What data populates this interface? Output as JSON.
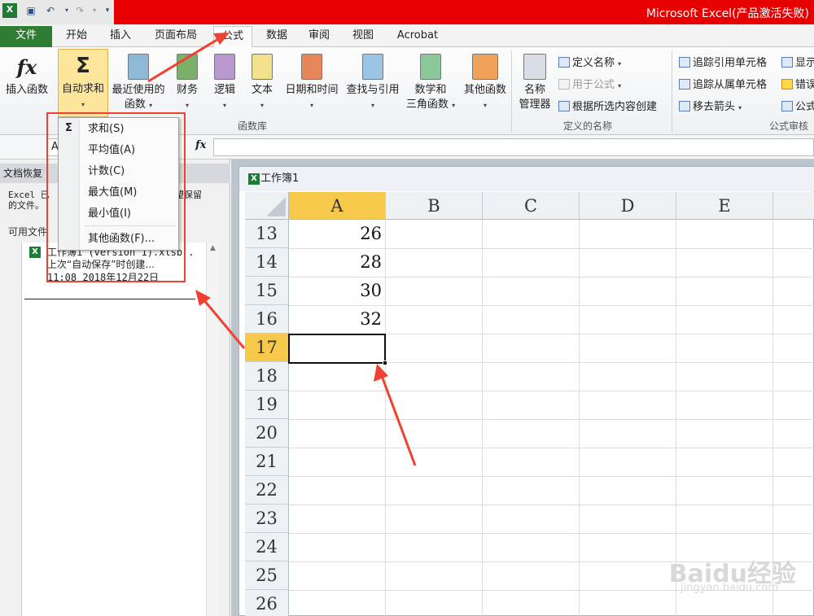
{
  "window": {
    "title": "Microsoft Excel(产品激活失败)"
  },
  "tabs": {
    "file": "文件",
    "items": [
      "开始",
      "插入",
      "页面布局",
      "公式",
      "数据",
      "审阅",
      "视图",
      "Acrobat"
    ]
  },
  "ribbon": {
    "insert_function": "插入函数",
    "autosum": "自动求和",
    "recent_line1": "最近使用的",
    "recent_line2": "函数",
    "financial": "财务",
    "logical": "逻辑",
    "text": "文本",
    "datetime": "日期和时间",
    "lookup": "查找与引用",
    "math_line1": "数学和",
    "math_line2": "三角函数",
    "other": "其他函数",
    "library_group": "函数库",
    "name_mgr_line1": "名称",
    "name_mgr_line2": "管理器",
    "define_name": "定义名称",
    "use_in_formula": "用于公式",
    "create_from_sel": "根据所选内容创建",
    "names_group": "定义的名称",
    "trace_precedents": "追踪引用单元格",
    "trace_dependents": "追踪从属单元格",
    "remove_arrows": "移去箭头",
    "show_partial": "显示",
    "error_partial": "错误",
    "eval_partial": "公式",
    "audit_group": "公式审核"
  },
  "autosum_menu": {
    "sigma": "Σ",
    "items": [
      "求和(S)",
      "平均值(A)",
      "计数(C)",
      "最大值(M)",
      "最小值(I)"
    ],
    "more": "其他函数(F)..."
  },
  "formula_bar": {
    "name_box": "A1",
    "fx": "fx"
  },
  "recovery_pane": {
    "header": "文档恢复",
    "message_line1": "Excel 已",
    "message_line1b": "望保留",
    "message_line2": "的文件。",
    "available_label": "可用文件",
    "file_name": "工作簿1 (version 1).xlsb .",
    "file_desc": "上次“自动保存”时创建...",
    "file_time": "11:08 2018年12月22日"
  },
  "workbook": {
    "title": "工作簿1"
  },
  "sheet": {
    "columns": [
      "A",
      "B",
      "C",
      "D",
      "E"
    ],
    "rows": [
      "13",
      "14",
      "15",
      "16",
      "17",
      "18",
      "19",
      "20",
      "21",
      "22",
      "23",
      "24",
      "25",
      "26"
    ],
    "colA_values": [
      "26",
      "28",
      "30",
      "32",
      "",
      "",
      "",
      "",
      "",
      "",
      "",
      "",
      "",
      ""
    ]
  },
  "watermark": {
    "line1": "Baidu经验",
    "line2": "jingyan.baidu.com"
  },
  "colors": {
    "title_red": "#e80000",
    "file_tab": "#2e7d32",
    "highlight": "#f04030",
    "active_header": "#f7c94a"
  }
}
